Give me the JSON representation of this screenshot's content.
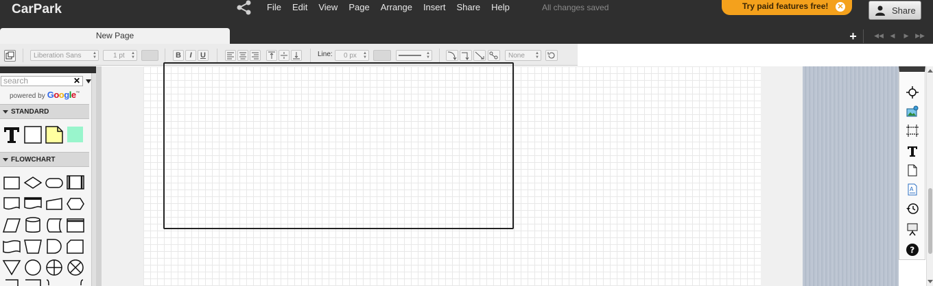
{
  "header": {
    "title": "CarPark",
    "menu": [
      "File",
      "Edit",
      "View",
      "Page",
      "Arrange",
      "Insert",
      "Share",
      "Help"
    ],
    "status": "All changes saved",
    "promo": "Try paid features free!",
    "share_label": "Share"
  },
  "tabs": {
    "page_tab": "New Page",
    "add": "+"
  },
  "toolbar": {
    "font": "Liberation Sans",
    "font_size": "1 pt",
    "bold": "B",
    "italic": "I",
    "underline": "U",
    "line_label": "Line:",
    "line_width": "0 px",
    "arrow_end": "None"
  },
  "sidebar": {
    "search_placeholder": "search",
    "powered_by": "powered by",
    "google": "Google",
    "sections": [
      "STANDARD",
      "FLOWCHART"
    ]
  },
  "colors": {
    "topbar": "#2f2f2f",
    "promo": "#f4a11c",
    "note_fill": "#ffffa0",
    "swatch": "#99f5cc"
  }
}
